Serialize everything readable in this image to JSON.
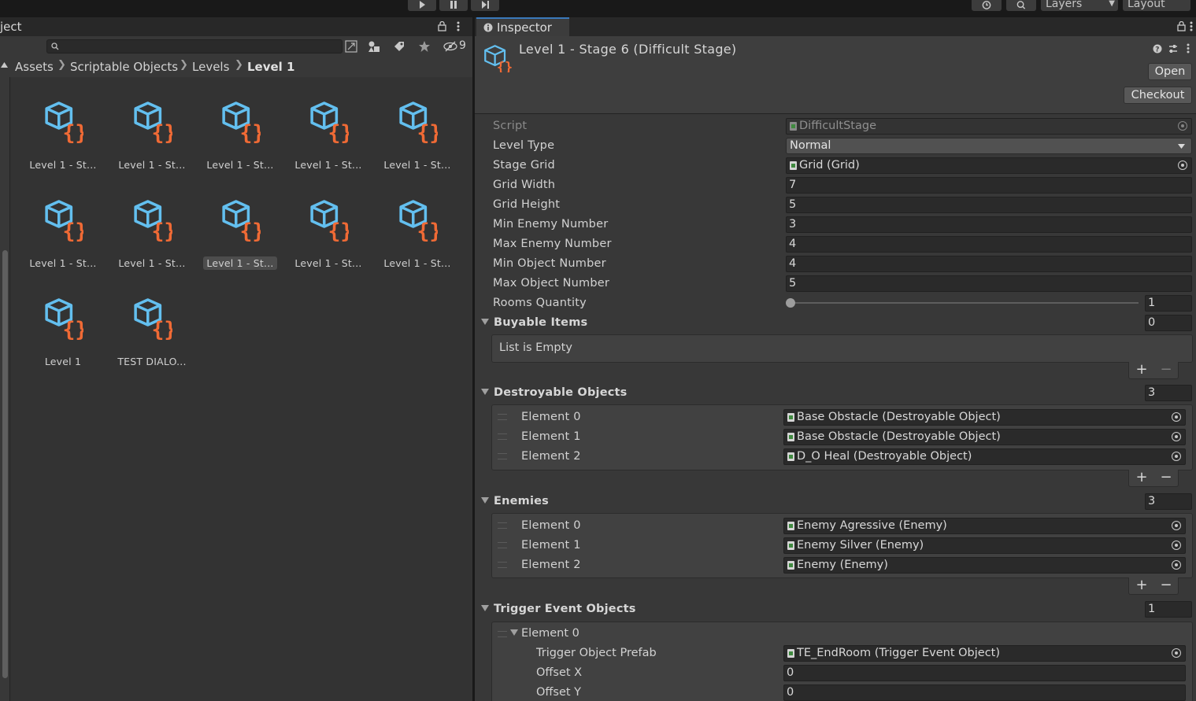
{
  "toolbar": {
    "play_icon": "play-icon",
    "pause_icon": "pause-icon",
    "step_icon": "step-icon",
    "layers_label": "Layers",
    "layout_label": "Layout"
  },
  "project": {
    "tab_title": "ject",
    "hidden_count": "9",
    "breadcrumb": [
      "Assets",
      "Scriptable Objects",
      "Levels",
      "Level 1"
    ],
    "assets": [
      "Level 1 - St...",
      "Level 1 - St...",
      "Level 1 - St...",
      "Level 1 - St...",
      "Level 1 - St...",
      "Level 1 - St...",
      "Level 1 - St...",
      "Level 1 - St...",
      "Level 1 - St...",
      "Level 1 - St...",
      "Level 1",
      "TEST DIALO..."
    ],
    "selected_index": 7
  },
  "inspector": {
    "tab_title": "Inspector",
    "object_title": "Level 1 - Stage 6 (Difficult Stage)",
    "open_label": "Open",
    "checkout_label": "Checkout",
    "script_label": "Script",
    "script_value": "DifficultStage",
    "level_type_label": "Level Type",
    "level_type_value": "Normal",
    "stage_grid_label": "Stage Grid",
    "stage_grid_value": "Grid (Grid)",
    "grid_width_label": "Grid Width",
    "grid_width_value": "7",
    "grid_height_label": "Grid Height",
    "grid_height_value": "5",
    "min_enemy_label": "Min Enemy Number",
    "min_enemy_value": "3",
    "max_enemy_label": "Max Enemy Number",
    "max_enemy_value": "4",
    "min_object_label": "Min Object Number",
    "min_object_value": "4",
    "max_object_label": "Max Object Number",
    "max_object_value": "5",
    "rooms_label": "Rooms Quantity",
    "rooms_value": "1",
    "buyable": {
      "label": "Buyable Items",
      "count": "0",
      "empty_text": "List is Empty"
    },
    "destroyable": {
      "label": "Destroyable Objects",
      "count": "3",
      "elements": [
        {
          "label": "Element 0",
          "value": "Base Obstacle (Destroyable Object)"
        },
        {
          "label": "Element 1",
          "value": "Base Obstacle (Destroyable Object)"
        },
        {
          "label": "Element 2",
          "value": "D_O Heal (Destroyable Object)"
        }
      ]
    },
    "enemies": {
      "label": "Enemies",
      "count": "3",
      "elements": [
        {
          "label": "Element 0",
          "value": "Enemy Agressive (Enemy)"
        },
        {
          "label": "Element 1",
          "value": "Enemy Silver (Enemy)"
        },
        {
          "label": "Element 2",
          "value": "Enemy (Enemy)"
        }
      ]
    },
    "trigger": {
      "label": "Trigger Event Objects",
      "count": "1",
      "element_label": "Element 0",
      "prefab_label": "Trigger Object Prefab",
      "prefab_value": "TE_EndRoom (Trigger Event Object)",
      "offset_x_label": "Offset X",
      "offset_x_value": "0",
      "offset_y_label": "Offset Y",
      "offset_y_value": "0"
    },
    "plus": "+",
    "minus": "−"
  }
}
